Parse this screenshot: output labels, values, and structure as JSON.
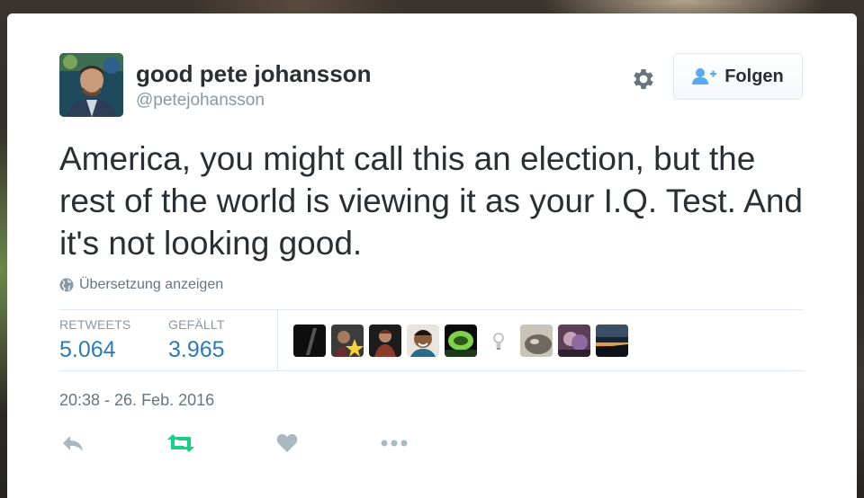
{
  "user": {
    "display_name": "good pete johansson",
    "screen_name": "@petejohansson",
    "avatar_icon": "profile-photo"
  },
  "header": {
    "settings_icon": "gear-icon",
    "follow_label": "Folgen",
    "follow_icon": "follow-person-plus-icon",
    "follow_icon_color": "#55acee"
  },
  "tweet": {
    "text": "America, you might call this an election, but the rest of the world is viewing it as your I.Q. Test. And it's not looking good.",
    "translate_label": "Übersetzung anzeigen",
    "translate_icon": "globe-icon",
    "timestamp": "20:38 - 26. Feb. 2016"
  },
  "stats": {
    "retweets_label": "RETWEETS",
    "retweets_value": "5.064",
    "likes_label": "GEFÄLLT",
    "likes_value": "3.965",
    "value_color": "#2b7bb9"
  },
  "likers": [
    "liker-avatar-1",
    "liker-avatar-2",
    "liker-avatar-3",
    "liker-avatar-4",
    "liker-avatar-5",
    "liker-avatar-6",
    "liker-avatar-7",
    "liker-avatar-8",
    "liker-avatar-9"
  ],
  "actions": {
    "reply_icon": "reply-icon",
    "retweet_icon": "retweet-icon",
    "retweet_color": "#19cf86",
    "like_icon": "heart-icon",
    "more_icon": "more-dots-icon"
  }
}
